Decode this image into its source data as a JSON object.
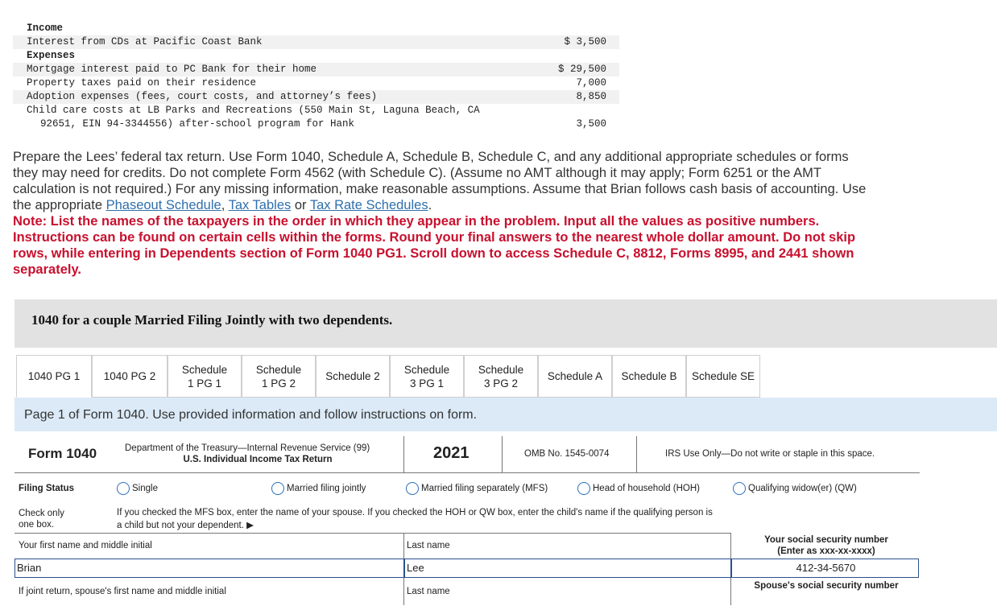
{
  "income_expenses": {
    "income_header": "Income",
    "income_rows": [
      {
        "label": "Interest from CDs at Pacific Coast Bank",
        "amount": "$ 3,500"
      }
    ],
    "expenses_header": "Expenses",
    "expense_rows": [
      {
        "label": "Mortgage interest paid to PC Bank for their home",
        "amount": "$ 29,500"
      },
      {
        "label": "Property taxes paid on their residence",
        "amount": "7,000"
      },
      {
        "label": "Adoption expenses (fees, court costs, and attorney’s fees)",
        "amount": "8,850"
      }
    ],
    "child_care": {
      "line1": "Child care costs at LB Parks and Recreations (550 Main St, Laguna Beach, CA",
      "line2": "92651, EIN 94-3344556) after-school program for Hank",
      "amount": "3,500"
    }
  },
  "instructions": {
    "text": "Prepare the Lees’ federal tax return. Use Form 1040, Schedule A, Schedule B, Schedule C, and any additional appropriate schedules or forms they may need for credits. Do not complete Form 4562 (with Schedule C). (Assume no AMT although it may apply; Form 6251 or the AMT calculation is not required.) For any missing information, make reasonable assumptions. Assume that Brian follows cash basis of accounting. Use the appropriate ",
    "link1": "Phaseout Schedule",
    "sep1": ", ",
    "link2": "Tax Tables",
    "sep2": " or ",
    "link3": "Tax Rate Schedules",
    "end": ".",
    "note": "Note: List the names of the taxpayers in the order in which they appear in the problem. Input all the values as positive numbers. Instructions can be found on certain cells within the forms. Round your final answers to the nearest whole dollar amount. Do not skip rows, while entering in Dependents section of Form 1040 PG1. Scroll down to access Schedule C, 8812, Forms 8995, and 2441 shown separately."
  },
  "banner": "1040 for a couple Married Filing Jointly with two dependents.",
  "tabs": [
    {
      "label": "1040 PG 1"
    },
    {
      "label": "1040 PG 2"
    },
    {
      "label": "Schedule 1 PG 1"
    },
    {
      "label": "Schedule 1 PG 2"
    },
    {
      "label": "Schedule 2"
    },
    {
      "label": "Schedule 3 PG 1"
    },
    {
      "label": "Schedule 3 PG 2"
    },
    {
      "label": "Schedule A"
    },
    {
      "label": "Schedule B"
    },
    {
      "label": "Schedule SE"
    }
  ],
  "info_bar": "Page 1 of Form 1040. Use provided information and follow instructions on form.",
  "form": {
    "form_name": "Form 1040",
    "dept_line1": "Department of the Treasury—Internal Revenue Service (99)",
    "dept_line2": "U.S. Individual Income Tax Return",
    "year": "2021",
    "omb": "OMB No. 1545-0074",
    "irs_use": "IRS Use Only—Do not write or staple in this space.",
    "filing_status_label": "Filing Status",
    "check_only_1": "Check only",
    "check_only_2": "one box.",
    "filing_options": [
      "Single",
      "Married filing jointly",
      "Married filing separately (MFS)",
      "Head of household (HOH)",
      "Qualifying widow(er) (QW)"
    ],
    "mfs_note_1": "If you checked the MFS box, enter the name of your spouse. If you checked the HOH or QW box, enter the child's name if the qualifying person is",
    "mfs_note_2": "a child but not your dependent. ▶",
    "first_name_label": "Your first name and middle initial",
    "first_name_value": "Brian",
    "last_name_label": "Last name",
    "last_name_value": "Lee",
    "ssn_label_1": "Your social security number",
    "ssn_label_2": "(Enter as xxx-xx-xxxx)",
    "ssn_value": "412-34-5670",
    "spouse_first_label": "If joint return, spouse's first name and middle initial",
    "spouse_last_label": "Last name",
    "spouse_ssn_label": "Spouse's social security number"
  }
}
